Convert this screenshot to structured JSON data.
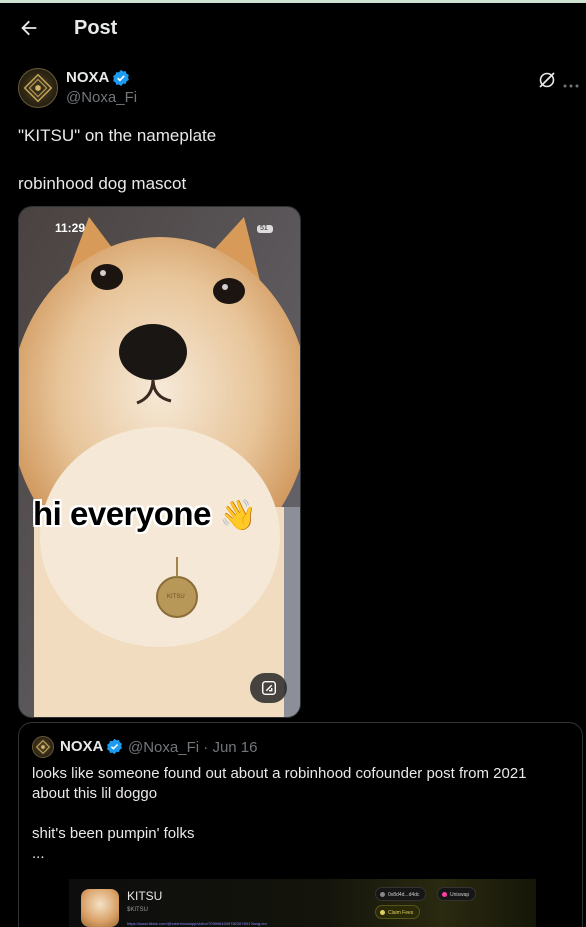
{
  "header": {
    "title": "Post"
  },
  "post": {
    "author_name": "NOXA",
    "author_handle": "@Noxa_Fi",
    "text": "\"KITSU\" on the nameplate\n\nrobinhood dog mascot",
    "media": {
      "status_time": "11:29",
      "battery": "51",
      "caption": "hi everyone",
      "caption_emoji": "👋",
      "nameplate": "KITSU"
    }
  },
  "quoted_post": {
    "author_name": "NOXA",
    "author_handle": "@Noxa_Fi",
    "separator": "·",
    "date": "Jun 16",
    "text": "looks like someone found out about a robinhood cofounder post from 2021 about this lil doggo\n\nshit's been pumpin' folks\n...",
    "preview": {
      "token_name": "KITSU",
      "ticker": "$KITSU",
      "url": "https://www.tiktok.com/@robinhoodapp/video/7099964349782267691?lang=en",
      "address_pill": "0x8d4d...d4dc",
      "dex_pill": "Uniswap",
      "claim_pill": "Claim Fees"
    }
  },
  "colors": {
    "background": "#000000",
    "text_primary": "#e7e9ea",
    "text_secondary": "#71767b",
    "verified_blue": "#1d9bf0",
    "border": "#2f3336"
  }
}
